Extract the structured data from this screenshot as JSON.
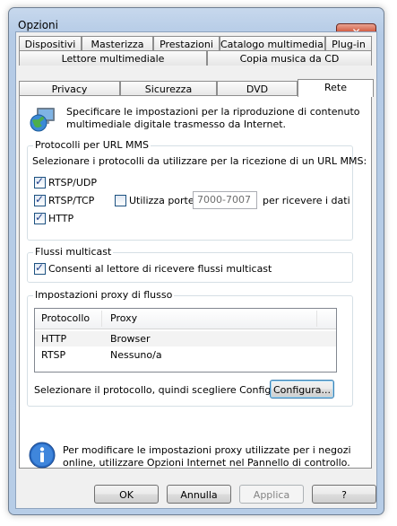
{
  "window": {
    "title": "Opzioni",
    "close_symbol": "✕"
  },
  "tabs": {
    "row1": [
      "Dispositivi",
      "Masterizza",
      "Prestazioni",
      "Catalogo multimediale",
      "Plug-in"
    ],
    "row2": [
      "Lettore multimediale",
      "Copia musica da CD"
    ],
    "row3": [
      "Privacy",
      "Sicurezza",
      "DVD",
      "Rete"
    ],
    "active": "Rete"
  },
  "intro": {
    "icon": "network-globe-icon",
    "text": "Specificare le impostazioni per la riproduzione di contenuto multimediale digitale trasmesso da Internet."
  },
  "protocols": {
    "legend": "Protocolli per URL MMS",
    "description": "Selezionare i protocolli da utilizzare per la ricezione di un URL MMS:",
    "rtsp_udp": {
      "label": "RTSP/UDP",
      "checked": true
    },
    "rtsp_tcp": {
      "label": "RTSP/TCP",
      "checked": true
    },
    "http": {
      "label": "HTTP",
      "checked": true
    },
    "use_ports": {
      "label": "Utilizza porte",
      "checked": false
    },
    "ports_value": "7000-7007",
    "ports_suffix": "per ricevere i dati"
  },
  "multicast": {
    "legend": "Flussi multicast",
    "allow": {
      "label": "Consenti al lettore di ricevere flussi multicast",
      "checked": true
    }
  },
  "proxy": {
    "legend": "Impostazioni proxy di flusso",
    "columns": [
      "Protocollo",
      "Proxy"
    ],
    "rows": [
      {
        "protocol": "HTTP",
        "proxy": "Browser"
      },
      {
        "protocol": "RTSP",
        "proxy": "Nessuno/a"
      }
    ],
    "instruction": "Selezionare il protocollo, quindi scegliere Configura.",
    "configure_label": "Configura..."
  },
  "info": {
    "icon": "info-icon",
    "text": "Per modificare le impostazioni proxy utilizzate per i negozi online, utilizzare Opzioni Internet nel Pannello di controllo."
  },
  "footer": {
    "ok": "OK",
    "cancel": "Annulla",
    "apply": "Applica",
    "help": "?"
  }
}
